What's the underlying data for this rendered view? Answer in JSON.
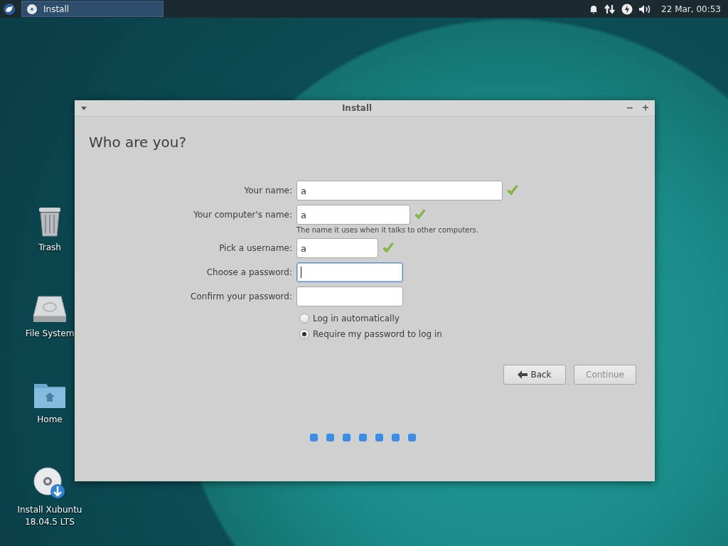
{
  "panel": {
    "task": {
      "label": "Install",
      "selected": true
    },
    "clock": "22 Mar, 00:53"
  },
  "desktop_icons": [
    {
      "kind": "trash",
      "label": "Trash"
    },
    {
      "kind": "drive",
      "label": "File System"
    },
    {
      "kind": "home",
      "label": "Home"
    },
    {
      "kind": "installer",
      "label": "Install Xubuntu 18.04.5 LTS"
    }
  ],
  "window": {
    "title": "Install",
    "heading": "Who are you?",
    "fields": [
      {
        "label": "Your name:",
        "value": "a",
        "valid": true,
        "focused": false
      },
      {
        "label": "Your computer's name:",
        "value": "a",
        "valid": true,
        "focused": false,
        "hint": "The name it uses when it talks to other computers."
      },
      {
        "label": "Pick a username:",
        "value": "a",
        "valid": true,
        "focused": false
      },
      {
        "label": "Choose a password:",
        "valid": false,
        "focused": true
      },
      {
        "label": "Confirm your password:",
        "valid": false,
        "focused": false
      }
    ],
    "login_options": [
      {
        "label": "Log in automatically",
        "selected": false
      },
      {
        "label": "Require my password to log in",
        "selected": true
      }
    ],
    "buttons": [
      {
        "kind": "back",
        "label": "Back",
        "disabled": false
      },
      {
        "kind": "continue",
        "label": "Continue",
        "disabled": true
      }
    ]
  }
}
